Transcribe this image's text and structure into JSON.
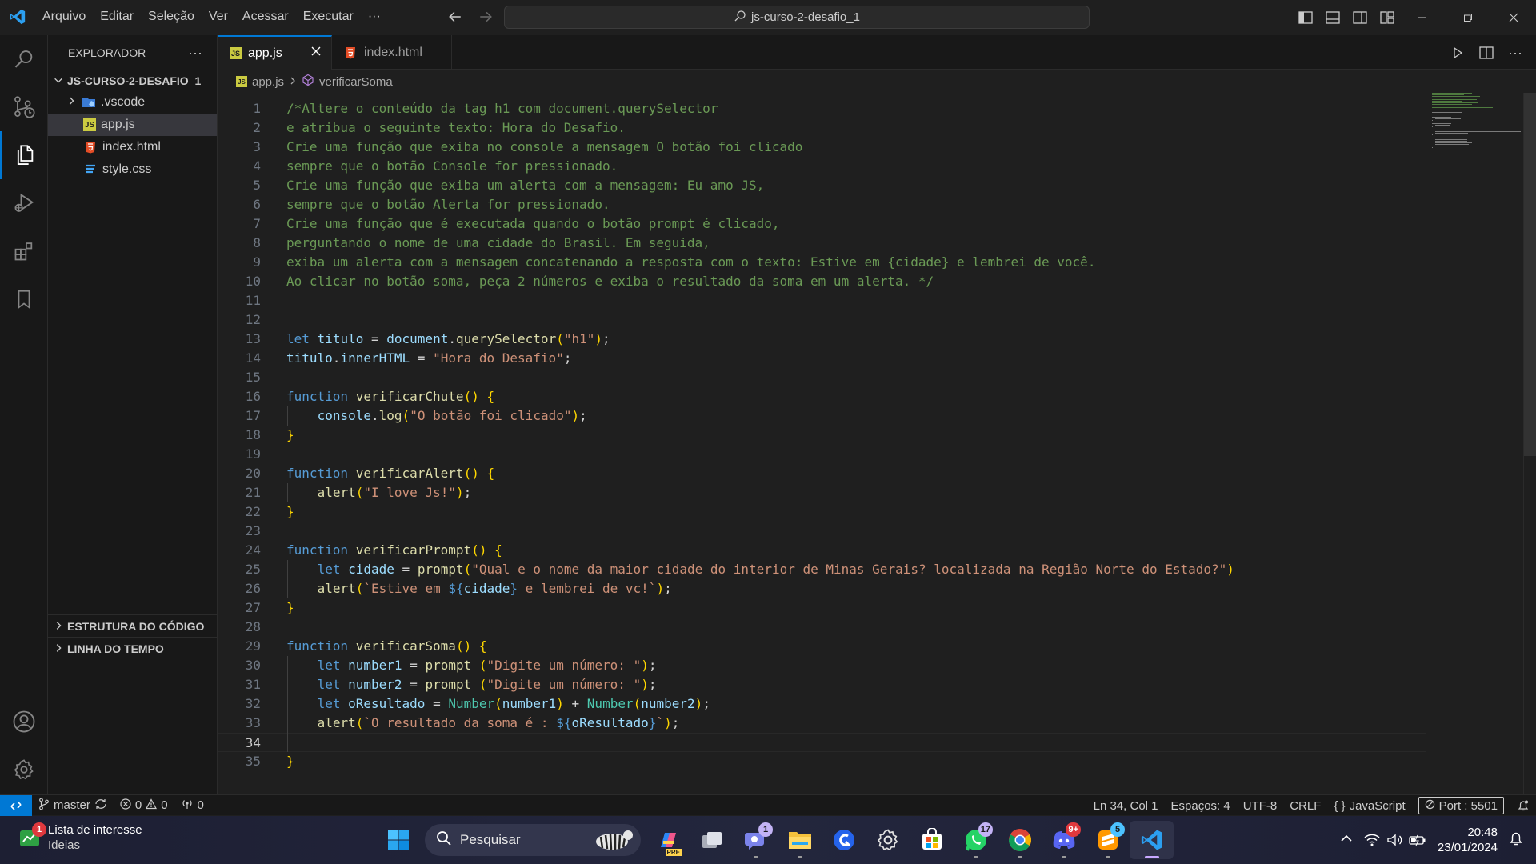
{
  "menu": [
    "Arquivo",
    "Editar",
    "Seleção",
    "Ver",
    "Acessar",
    "Executar",
    "···"
  ],
  "command_center": "js-curso-2-desafio_1",
  "sidebar": {
    "title": "EXPLORADOR",
    "more": "···",
    "folder": "JS-CURSO-2-DESAFIO_1",
    "items": [
      {
        "label": ".vscode",
        "kind": "folder"
      },
      {
        "label": "app.js",
        "kind": "js",
        "selected": true
      },
      {
        "label": "index.html",
        "kind": "html"
      },
      {
        "label": "style.css",
        "kind": "css"
      }
    ],
    "outline": "ESTRUTURA DO CÓDIGO",
    "timeline": "LINHA DO TEMPO"
  },
  "tabs": [
    {
      "label": "app.js",
      "active": true,
      "icon": "js-file-icon"
    },
    {
      "label": "index.html",
      "active": false,
      "icon": "html-file-icon"
    }
  ],
  "breadcrumb": {
    "file": "app.js",
    "symbol": "verificarSoma"
  },
  "editor": {
    "language": "JavaScript",
    "active_line": 34,
    "lines": [
      "/*Altere o conteúdo da tag h1 com document.querySelector",
      "e atribua o seguinte texto: Hora do Desafio.",
      "Crie uma função que exiba no console a mensagem O botão foi clicado",
      "sempre que o botão Console for pressionado.",
      "Crie uma função que exiba um alerta com a mensagem: Eu amo JS,",
      "sempre que o botão Alerta for pressionado.",
      "Crie uma função que é executada quando o botão prompt é clicado,",
      "perguntando o nome de uma cidade do Brasil. Em seguida,",
      "exiba um alerta com a mensagem concatenando a resposta com o texto: Estive em {cidade} e lembrei de você.",
      "Ao clicar no botão soma, peça 2 números e exiba o resultado da soma em um alerta. */",
      "",
      "",
      "let titulo = document.querySelector(\"h1\");",
      "titulo.innerHTML = \"Hora do Desafio\";",
      "",
      "function verificarChute() {",
      "    console.log(\"O botão foi clicado\");",
      "}",
      "",
      "function verificarAlert() {",
      "    alert(\"I love Js!\");",
      "}",
      "",
      "function verificarPrompt() {",
      "    let cidade = prompt(\"Qual e o nome da maior cidade do interior de Minas Gerais? localizada na Região Norte do Estado?\")",
      "    alert(`Estive em ${cidade} e lembrei de vc!`);",
      "}",
      "",
      "function verificarSoma() {",
      "    let number1 = prompt (\"Digite um número: \");",
      "    let number2 = prompt (\"Digite um número: \");",
      "    let oResultado = Number(number1) + Number(number2);",
      "    alert(`O resultado da soma é : ${oResultado}`);",
      "",
      "}"
    ]
  },
  "status": {
    "branch": "master",
    "errors": "0",
    "warnings": "0",
    "ports_forwarded": "0",
    "position": "Ln 34, Col 1",
    "spaces": "Espaços: 4",
    "encoding": "UTF-8",
    "eol": "CRLF",
    "language": "JavaScript",
    "port": "Port : 5501"
  },
  "taskbar": {
    "widget_title": "Lista de interesse",
    "widget_sub": "Ideias",
    "widget_badge": "1",
    "search_placeholder": "Pesquisar",
    "teams_badge": "1",
    "whatsapp_badge": "17",
    "discord_badge": "9+",
    "sublime_badge": "5",
    "time": "20:48",
    "date": "23/01/2024"
  },
  "colors": {
    "accent": "#0078d4",
    "comment": "#6a9955",
    "keyword": "#569cd6",
    "function": "#dcdcaa",
    "variable": "#9cdcfe",
    "string": "#ce9178"
  }
}
